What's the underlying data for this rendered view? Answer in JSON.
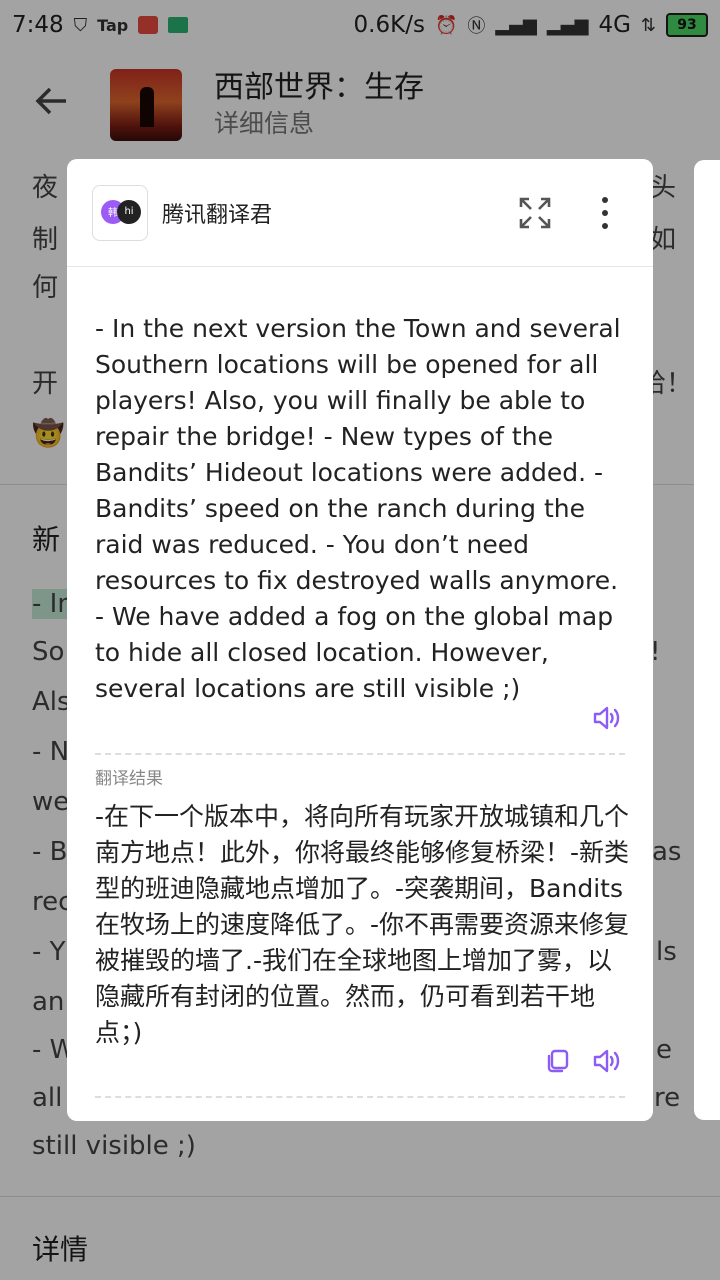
{
  "status_bar": {
    "time": "7:48",
    "tap_label": "Tap",
    "network_speed": "0.6K/s",
    "network_type": "4G",
    "battery": "93"
  },
  "app_bar": {
    "title": "西部世界：生存",
    "subtitle": "详细信息"
  },
  "background": {
    "intro_lines": [
      "夜",
      "制",
      "何"
    ],
    "intro_right_fragments": [
      "头",
      "如"
    ],
    "start_line_left": "开",
    "start_line_right": "哈！",
    "emoji": "🤠",
    "section_new_title": "新",
    "whatsnew_lines": [
      "- In",
      "So",
      "Als",
      "- N",
      "we",
      "- B",
      "rec",
      "- Y",
      "an",
      "- W",
      "all"
    ],
    "whatsnew_right_fragments": [
      "!",
      "as",
      "ls",
      "e",
      "re"
    ],
    "whatsnew_last_line": "still visible ;)",
    "details_title": "详情"
  },
  "translator": {
    "name": "腾讯翻译君",
    "logo_left": "韩",
    "logo_right": "hi",
    "source_text": "- In the next version the Town and several Southern locations will be opened for all players! Also, you will finally be able to repair the bridge! - New types of the Bandits’ Hideout locations were added. - Bandits’ speed on the ranch during the raid was reduced. - You don’t need resources to fix destroyed walls anymore. - We have added a fog on the global map to hide all closed location. However, several locations are still visible ;)",
    "result_label": "翻译结果",
    "result_text": "-在下一个版本中，将向所有玩家开放城镇和几个南方地点！此外，你将最终能够修复桥梁！-新类型的班迪隐藏地点增加了。-突袭期间，Bandits在牧场上的速度降低了。-你不再需要资源来修复被摧毁的墙了.-我们在全球地图上增加了雾，以隐藏所有封闭的位置。然而，仍可看到若干地点；)",
    "accent_color": "#8b5cf6"
  }
}
